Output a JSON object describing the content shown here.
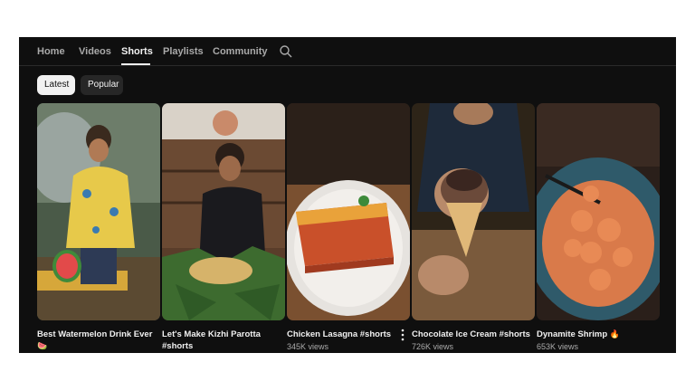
{
  "tabs": [
    {
      "label": "Home"
    },
    {
      "label": "Videos"
    },
    {
      "label": "Shorts"
    },
    {
      "label": "Playlists"
    },
    {
      "label": "Community"
    }
  ],
  "active_tab": "Shorts",
  "icons": {
    "search": "search-icon",
    "more": "more-vert-icon"
  },
  "chips": {
    "latest": "Latest",
    "popular": "Popular"
  },
  "shorts": [
    {
      "title": "Best Watermelon Drink Ever",
      "emoji": "🍉",
      "views": ""
    },
    {
      "title": "Let's Make Kizhi Parotta #shorts",
      "views": ""
    },
    {
      "title": "Chicken Lasagna #shorts",
      "views": "345K views"
    },
    {
      "title": "Chocolate Ice Cream #shorts",
      "views": "726K views"
    },
    {
      "title": "Dynamite Shrimp",
      "emoji": "🔥",
      "views": "653K views"
    }
  ],
  "colors": {
    "background": "#0f0f0f",
    "text": "#f1f1f1",
    "muted": "#aaaaaa",
    "chip_active": "#f1f1f1",
    "chip": "#272727"
  }
}
